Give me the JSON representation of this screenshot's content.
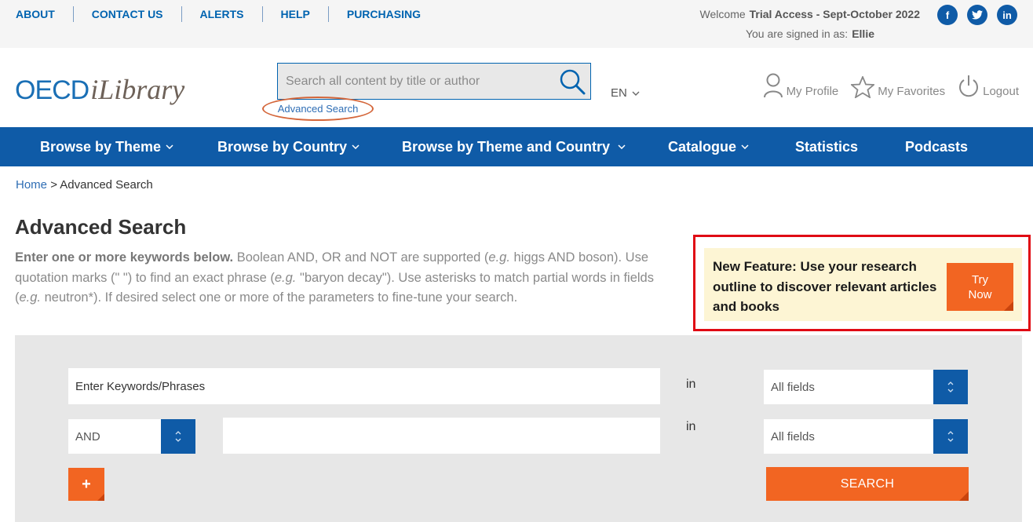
{
  "topbar": {
    "links": [
      "ABOUT",
      "CONTACT US",
      "ALERTS",
      "HELP",
      "PURCHASING"
    ],
    "welcome_label": "Welcome",
    "welcome_value": "Trial Access - Sept-October 2022",
    "signed_label": "You are signed in as:",
    "signed_value": "Ellie",
    "social": [
      {
        "icon": "facebook-icon",
        "glyph": "f"
      },
      {
        "icon": "twitter-icon",
        "glyph": "t"
      },
      {
        "icon": "linkedin-icon",
        "glyph": "in"
      }
    ]
  },
  "header": {
    "logo_oecd": "OECD",
    "logo_ilibrary": "iLibrary",
    "search_placeholder": "Search all content by title or author",
    "advanced_search_link": "Advanced Search",
    "language": "EN",
    "my_profile": "My Profile",
    "my_favorites": "My Favorites",
    "logout": "Logout"
  },
  "nav": {
    "items": [
      {
        "label": "Browse by Theme",
        "dropdown": true
      },
      {
        "label": "Browse by Country",
        "dropdown": true
      },
      {
        "label": "Browse by Theme and Country",
        "dropdown": true
      },
      {
        "label": "Catalogue",
        "dropdown": true
      },
      {
        "label": "Statistics",
        "dropdown": false
      },
      {
        "label": "Podcasts",
        "dropdown": false
      }
    ]
  },
  "breadcrumb": {
    "home": "Home",
    "current": "> Advanced Search"
  },
  "page": {
    "title": "Advanced Search",
    "intro_bold": "Enter one or more keywords below.",
    "intro_1": " Boolean AND, OR and NOT are supported (",
    "intro_eg1": "e.g.",
    "intro_2": " higgs AND boson). Use quotation marks (\" \") to find an exact phrase (",
    "intro_eg2": "e.g.",
    "intro_3": " \"baryon decay\"). Use asterisks to match partial words in fields (",
    "intro_eg3": "e.g.",
    "intro_4": " neutron*). If desired select one or more of the parameters to fine-tune your search."
  },
  "feature": {
    "text": "New Feature: Use your research outline to discover relevant articles and books",
    "button_line1": "Try",
    "button_line2": "Now"
  },
  "form": {
    "keyword_placeholder": "Enter Keywords/Phrases",
    "second_value": "",
    "in_label": "in",
    "field_select_1": "All fields",
    "field_select_2": "All fields",
    "operator": "AND",
    "add_button": "+",
    "search_button": "SEARCH"
  },
  "colors": {
    "primary_blue": "#0f5ba7",
    "link_blue": "#0063b0",
    "accent_orange": "#f26522",
    "highlight_red": "#e00a14",
    "feature_bg": "#fdf5d4"
  }
}
